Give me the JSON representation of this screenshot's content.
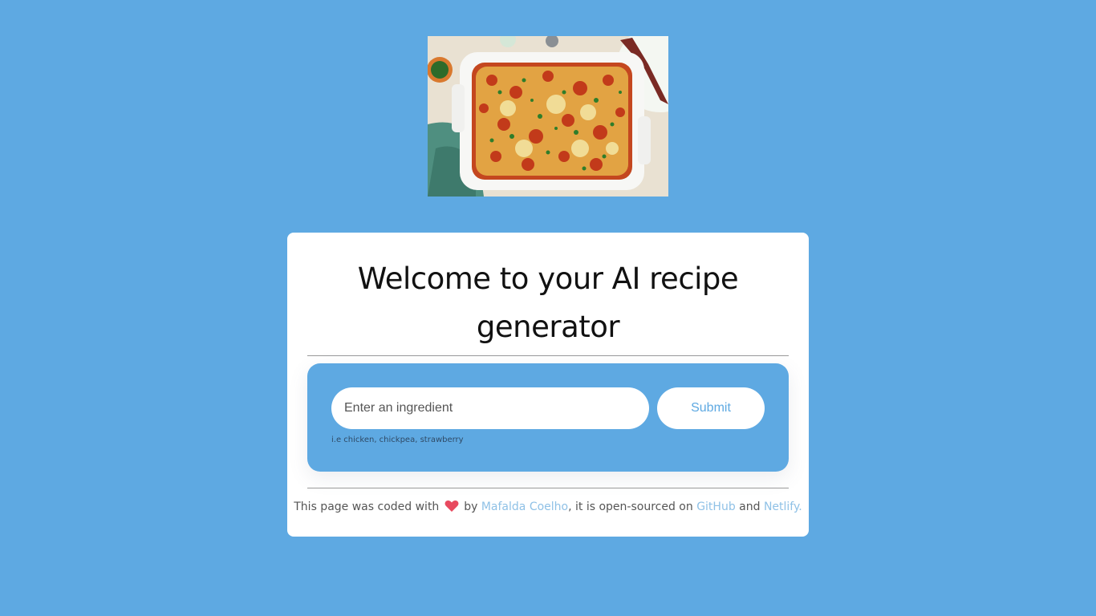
{
  "hero": {
    "image_icon": "lasagna-dish-photo"
  },
  "card": {
    "title": "Welcome to your AI recipe generator",
    "form": {
      "input_placeholder": "Enter an ingredient",
      "input_value": "",
      "submit_label": "Submit",
      "hint": "i.e chicken, chickpea, strawberry"
    },
    "footer": {
      "text_1": "This page was coded with",
      "heart_icon": "heart-icon",
      "text_2": "by",
      "author_link": "Mafalda Coelho",
      "text_3": ", it is open-sourced on",
      "github_link": "GitHub",
      "text_4": "and",
      "netlify_link": "Netlify."
    }
  },
  "colors": {
    "background": "#5ea9e2",
    "card": "#ffffff",
    "link": "#8fc1e6",
    "heart": "#e84a5f"
  }
}
